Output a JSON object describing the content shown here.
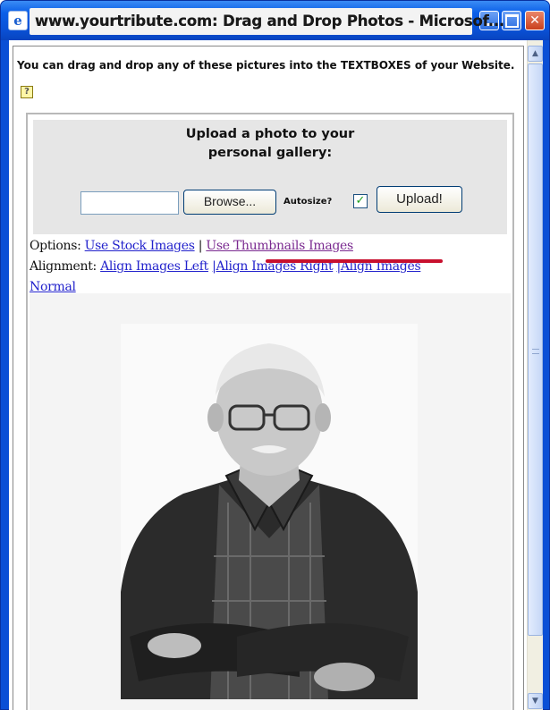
{
  "window": {
    "title": "www.yourtribute.com: Drag and Drop Photos - Microsof...",
    "min_icon": "minimize-icon",
    "max_icon": "maximize-icon",
    "close_icon": "close-icon",
    "app_icon": "ie-page-icon",
    "app_icon_glyph": "e",
    "close_glyph": "✕"
  },
  "intro": {
    "line": "You can drag and drop any of these pictures into the TEXTBOXES of your Website.",
    "help_glyph": "?"
  },
  "upload": {
    "title_line1": "Upload a photo to your",
    "title_line2": "personal gallery:",
    "file_value": "",
    "browse_label": "Browse...",
    "autosize_label": "Autosize?",
    "autosize_checked": true,
    "check_glyph": "✓",
    "upload_label": "Upload!"
  },
  "options": {
    "options_label": "Options:",
    "stock_link": "Use Stock Images",
    "separator": "|",
    "thumbnails_link": "Use Thumbnails Images",
    "alignment_label": "Alignment:",
    "align_left": "Align Images Left",
    "align_right": "|Align Images Right",
    "align_normal_part1": "|Align Images",
    "align_normal_part2": "Normal"
  },
  "photo": {
    "alt": "portrait of elderly man with glasses, arms crossed"
  },
  "scrollbar": {
    "up_glyph": "▲",
    "down_glyph": "▼"
  },
  "colors": {
    "titlebar": "#0a52d8",
    "link": "#2222cc",
    "visited_link": "#7a2a90",
    "highlight": "#c8102e",
    "checkbox": "#21a121"
  }
}
